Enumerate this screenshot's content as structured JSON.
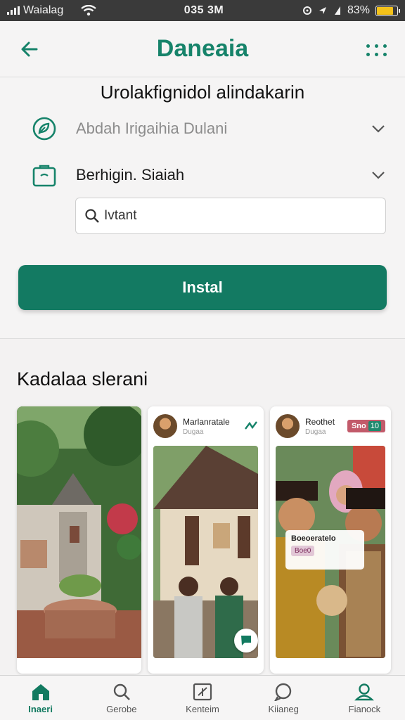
{
  "status_bar": {
    "carrier": "Waialag",
    "time": "035 3M",
    "battery_text": "83%",
    "battery_level": 0.83
  },
  "header": {
    "title": "Daneaia",
    "back_icon": "arrow-left-icon",
    "menu_icon": "dots-grid-icon"
  },
  "form": {
    "heading": "Urolakfignidol alindakarin",
    "field1": {
      "label": "Abdah Irigaihia Dulani",
      "icon": "leaf-icon"
    },
    "field2": {
      "label": "Berhigin. Siaiah",
      "icon": "bag-icon"
    },
    "search": {
      "placeholder": "Ivtant"
    },
    "install_label": "Instal"
  },
  "section": {
    "title": "Kadalaa slerani"
  },
  "cards": [
    {
      "name": "",
      "subtitle": ""
    },
    {
      "name": "Marlanratale",
      "subtitle": "Dugaa"
    },
    {
      "name": "Reothet",
      "subtitle": "Dugaa",
      "badge": "Sno",
      "badge_num": "10",
      "overlay_title": "Boeoeratelo",
      "overlay_tag": "Boe0"
    }
  ],
  "nav": [
    {
      "label": "Inaeri",
      "icon": "home-icon"
    },
    {
      "label": "Gerobe",
      "icon": "search-icon"
    },
    {
      "label": "Kenteim",
      "icon": "edit-square-icon"
    },
    {
      "label": "Kiianeg",
      "icon": "chat-bubble-icon"
    },
    {
      "label": "Fianock",
      "icon": "profile-icon"
    }
  ],
  "colors": {
    "accent": "#137a62",
    "title": "#16836a",
    "battery": "#f4c21a"
  }
}
